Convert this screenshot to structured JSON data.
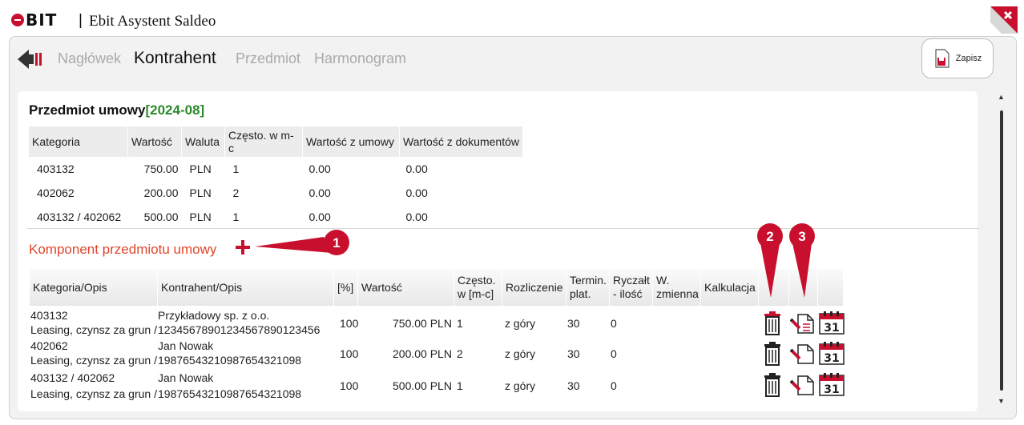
{
  "app": {
    "logo_text": "BIT",
    "separator": "|",
    "title": "Ebit Asystent Saldeo"
  },
  "nav": {
    "tabs": [
      {
        "label": "Nagłówek",
        "active": false
      },
      {
        "label": "Kontrahent",
        "active": true
      },
      {
        "label": "Przedmiot",
        "active": false
      },
      {
        "label": "Harmonogram",
        "active": false
      }
    ],
    "save_label": "Zapisz"
  },
  "section": {
    "title": "Przedmiot umowy",
    "period": "[2024-08]"
  },
  "summary_table": {
    "headers": [
      "Kategoria",
      "Wartość",
      "Waluta",
      "Często. w m-c",
      "Wartość z umowy",
      "Wartość z dokumentów"
    ],
    "rows": [
      [
        "403132",
        "750.00",
        "PLN",
        "1",
        "0.00",
        "0.00"
      ],
      [
        "402062",
        "200.00",
        "PLN",
        "2",
        "0.00",
        "0.00"
      ],
      [
        "403132 / 402062",
        "500.00",
        "PLN",
        "1",
        "0.00",
        "0.00"
      ]
    ]
  },
  "components": {
    "title": "Komponent przedmiotu umowy",
    "headers": {
      "kategoria": "Kategoria/Opis",
      "kontrahent": "Kontrahent/Opis",
      "procent": "[%]",
      "wartosc": "Wartość",
      "czesto_1": "Często.",
      "czesto_2": "w [m-c]",
      "rozliczenie": "Rozliczenie",
      "termin_1": "Termin.",
      "termin_2": "plat.",
      "ryczalt_1": "Ryczałt",
      "ryczalt_2": "- ilość",
      "wzmienna_1": "W.",
      "wzmienna_2": "zmienna",
      "kalkulacja": "Kalkulacja"
    },
    "rows": [
      {
        "kategoria": "403132",
        "opis": "Leasing, czynsz za grun /",
        "kontrahent": "Przykładowy sp. z o.o.",
        "konto": "12345678901234567890123456",
        "procent": "100",
        "wartosc": "750.00 PLN",
        "czesto": "1",
        "rozliczenie": "z góry",
        "termin": "30",
        "ryczalt": "0"
      },
      {
        "kategoria": "402062",
        "opis": "Leasing, czynsz za grun /",
        "kontrahent": "Jan Nowak",
        "konto": "19876543210987654321098",
        "procent": "100",
        "wartosc": "200.00 PLN",
        "czesto": "2",
        "rozliczenie": "z góry",
        "termin": "30",
        "ryczalt": "0"
      },
      {
        "kategoria": "403132 / 402062",
        "opis": "Leasing, czynsz za grun /",
        "kontrahent": "Jan Nowak",
        "konto": "19876543210987654321098",
        "procent": "100",
        "wartosc": "500.00 PLN",
        "czesto": "1",
        "rozliczenie": "z góry",
        "termin": "30",
        "ryczalt": "0"
      }
    ],
    "calendar_day": "31"
  },
  "callouts": [
    "1",
    "2",
    "3"
  ],
  "colors": {
    "accent_red": "#c8102e",
    "link_red": "#e0442b",
    "period_green": "#2a8a2a"
  },
  "icons": [
    "back-arrow-icon",
    "save-icon",
    "add-icon",
    "trash-icon",
    "edit-document-icon",
    "calendar-icon",
    "close-icon"
  ]
}
